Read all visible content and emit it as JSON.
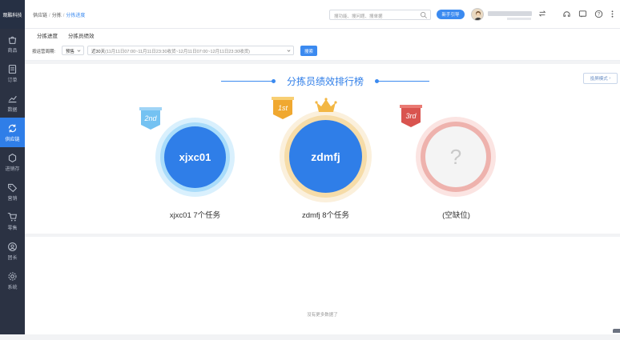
{
  "brand": {
    "logo_text": "观酷科技"
  },
  "sidebar": {
    "items": [
      {
        "label": "商品",
        "icon": "shopping-bag-icon"
      },
      {
        "label": "订单",
        "icon": "order-icon"
      },
      {
        "label": "数据",
        "icon": "chart-icon"
      },
      {
        "label": "供应链",
        "icon": "supply-chain-icon",
        "active": true
      },
      {
        "label": "进销存",
        "icon": "inventory-icon"
      },
      {
        "label": "营销",
        "icon": "tag-icon"
      },
      {
        "label": "零售",
        "icon": "cart-icon"
      },
      {
        "label": "团长",
        "icon": "user-icon"
      },
      {
        "label": "系统",
        "icon": "gear-icon"
      }
    ]
  },
  "header": {
    "breadcrumbs": [
      "供应链",
      "分拣",
      "分拣进度"
    ],
    "search_placeholder": "搜功能、搜问题、搜单据",
    "guide_button": "新手引导"
  },
  "tabs": [
    "分拣进度",
    "分拣员绩效"
  ],
  "filters": {
    "label": "按运营周期:",
    "select_value": "预售",
    "range_main": "近30天",
    "range_detail": "(11月11日07:00~11月11日23:30收货~12月11日07:00~12月11日23:30收货)",
    "search_button": "搜索"
  },
  "ranking": {
    "title": "分拣员绩效排行榜",
    "screen_mode": "投屏模式",
    "places": [
      {
        "rank": "2nd",
        "name": "xjxc01",
        "caption": "xjxc01 7个任务"
      },
      {
        "rank": "1st",
        "name": "zdmfj",
        "caption": "zdmfj 8个任务"
      },
      {
        "rank": "3rd",
        "name": "?",
        "caption": "(空缺位)"
      }
    ]
  },
  "footer": {
    "no_more": "没有更多数据了"
  },
  "colors": {
    "accent": "#3b8af0",
    "sidebar": "#2b3243",
    "gold": "#f0a830",
    "silver_ring": "#bfe3fb",
    "bronze": "#d9544f"
  }
}
